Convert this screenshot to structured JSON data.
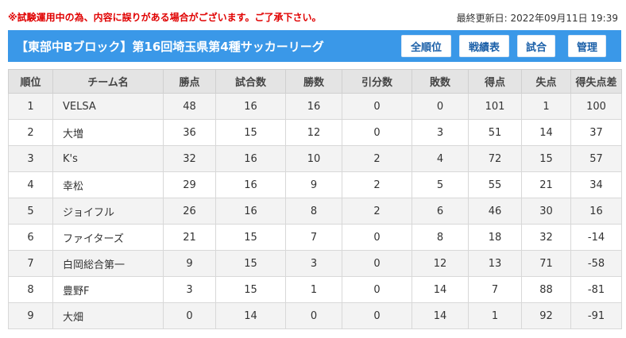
{
  "notice": "※試験運用中の為、内容に誤りがある場合がございます。ご了承下さい。",
  "last_updated": "最終更新日: 2022年09月11日 19:39",
  "header": {
    "title": "【東部中Bブロック】第16回埼玉県第4種サッカーリーグ",
    "buttons": {
      "standings": "全順位",
      "records": "戦績表",
      "matches": "試合",
      "admin": "管理"
    }
  },
  "colors": {
    "header_bg": "#3a98e8",
    "notice_text": "#e00000",
    "button_text": "#1a5fa8",
    "table_header_bg": "#e4e4e4",
    "row_alt_bg": "#f3f3f3"
  },
  "table": {
    "columns": [
      "順位",
      "チーム名",
      "勝点",
      "試合数",
      "勝数",
      "引分数",
      "敗数",
      "得点",
      "失点",
      "得失点差"
    ],
    "rows": [
      [
        "1",
        "VELSA",
        "48",
        "16",
        "16",
        "0",
        "0",
        "101",
        "1",
        "100"
      ],
      [
        "2",
        "大増",
        "36",
        "15",
        "12",
        "0",
        "3",
        "51",
        "14",
        "37"
      ],
      [
        "3",
        "K's",
        "32",
        "16",
        "10",
        "2",
        "4",
        "72",
        "15",
        "57"
      ],
      [
        "4",
        "幸松",
        "29",
        "16",
        "9",
        "2",
        "5",
        "55",
        "21",
        "34"
      ],
      [
        "5",
        "ジョイフル",
        "26",
        "16",
        "8",
        "2",
        "6",
        "46",
        "30",
        "16"
      ],
      [
        "6",
        "ファイターズ",
        "21",
        "15",
        "7",
        "0",
        "8",
        "18",
        "32",
        "-14"
      ],
      [
        "7",
        "白岡総合第一",
        "9",
        "15",
        "3",
        "0",
        "12",
        "13",
        "71",
        "-58"
      ],
      [
        "8",
        "豊野F",
        "3",
        "15",
        "1",
        "0",
        "14",
        "7",
        "88",
        "-81"
      ],
      [
        "9",
        "大畑",
        "0",
        "14",
        "0",
        "0",
        "14",
        "1",
        "92",
        "-91"
      ]
    ]
  }
}
